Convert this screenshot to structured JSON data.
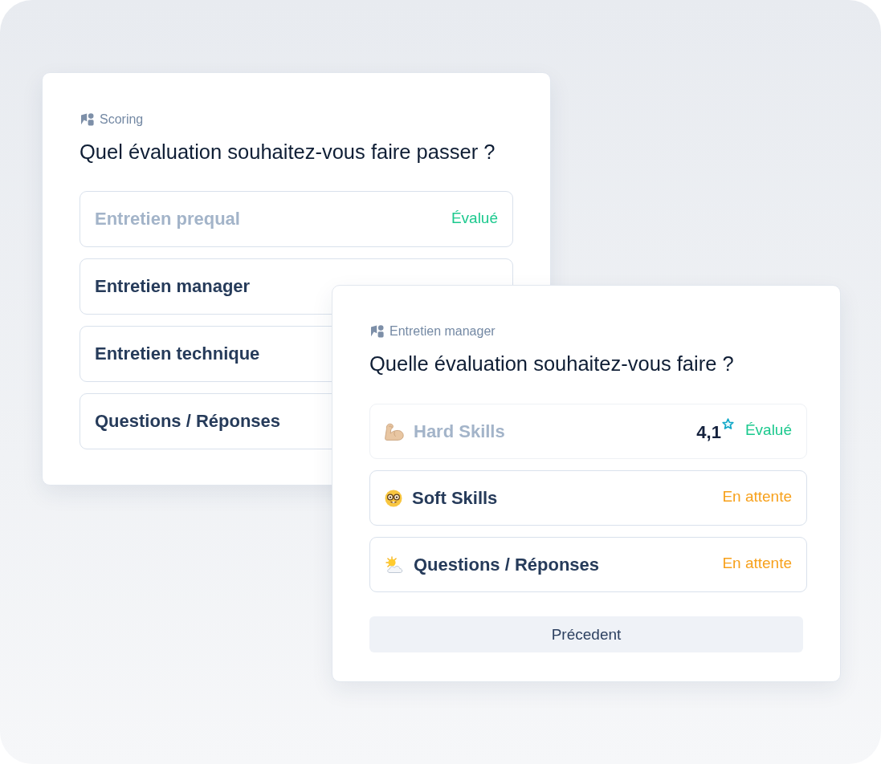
{
  "cards": [
    {
      "eyebrow": "Scoring",
      "title": "Quel évaluation souhaitez-vous faire passer ?",
      "items": [
        {
          "label": "Entretien prequal",
          "evaluated": true,
          "status": "Évalué"
        },
        {
          "label": "Entretien manager",
          "evaluated": false
        },
        {
          "label": "Entretien technique",
          "evaluated": false
        },
        {
          "label": "Questions / Réponses",
          "evaluated": false
        }
      ]
    },
    {
      "eyebrow": "Entretien manager",
      "title": "Quelle évaluation souhaitez-vous faire ?",
      "items": [
        {
          "label": "Hard Skills",
          "evaluated": true,
          "disabled": true,
          "score": "4,1",
          "status": "Évalué"
        },
        {
          "label": "Soft Skills",
          "evaluated": false,
          "disabled": false,
          "status": "En attente"
        },
        {
          "label": "Questions / Réponses",
          "evaluated": false,
          "disabled": false,
          "status": "En attente"
        }
      ],
      "button": "Précedent"
    }
  ]
}
